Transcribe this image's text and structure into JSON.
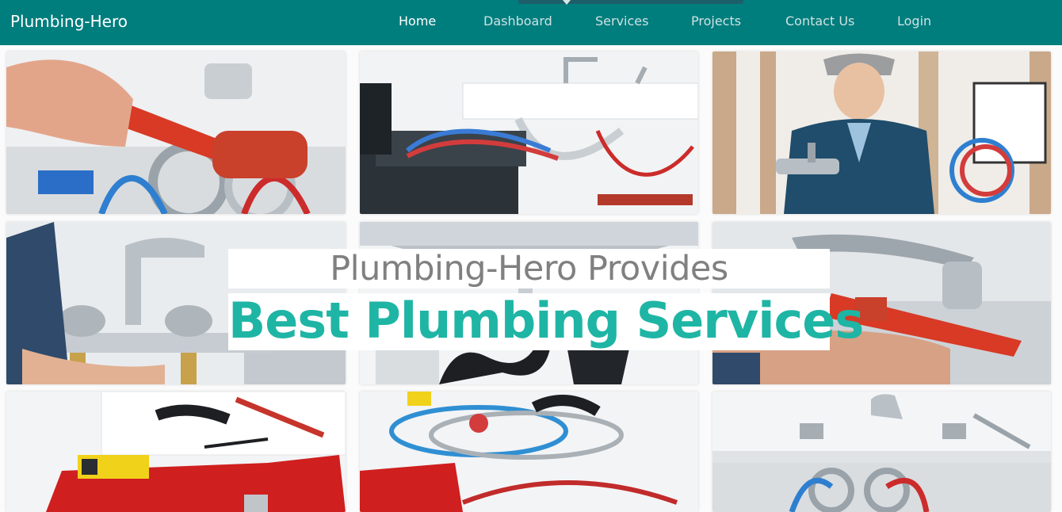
{
  "navbar": {
    "brand": "Plumbing-Hero",
    "items": [
      {
        "label": "Home",
        "active": true
      },
      {
        "label": "Dashboard",
        "active": false
      },
      {
        "label": "Services",
        "active": false
      },
      {
        "label": "Projects",
        "active": false
      },
      {
        "label": "Contact Us",
        "active": false
      },
      {
        "label": "Login",
        "active": false
      }
    ]
  },
  "hero": {
    "line1": "Plumbing-Hero Provides",
    "line2": "Best Plumbing Services",
    "images": [
      "wrench-on-pipes-image",
      "toolbox-under-sink-image",
      "plumber-with-faucet-image",
      "faucet-install-image",
      "sink-drain-pipes-image",
      "wrench-on-faucet-image",
      "red-toolbox-pipes-image",
      "hoses-and-toolbox-image",
      "sink-valves-image"
    ]
  },
  "colors": {
    "navbar": "#007d7d",
    "accent": "#1fb5a5",
    "subtitle": "#808080"
  }
}
